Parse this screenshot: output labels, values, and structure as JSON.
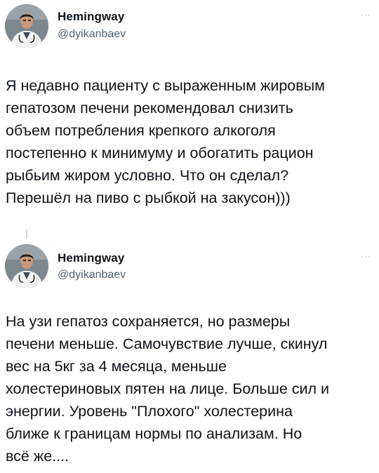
{
  "tweets": [
    {
      "author": {
        "name": "Hemingway",
        "handle": "@dyikanbaev",
        "avatar_icon": "doctor-portrait"
      },
      "more_icon": "ellipsis-icon",
      "more_label": "···",
      "text": "Я недавно пациенту с выраженным жировым\nгепатозом печени рекомендовал снизить\nобъем потребления крепкого алкоголя\nпостепенно к минимуму и обогатить рацион\nрыбьим жиром условно. Что он сделал?\nПерешёл на пиво с рыбкой на закусон)))"
    },
    {
      "author": {
        "name": "Hemingway",
        "handle": "@dyikanbaev",
        "avatar_icon": "doctor-portrait"
      },
      "more_icon": "ellipsis-icon",
      "more_label": "···",
      "text": "На узи гепатоз сохраняется, но размеры\nпечени меньше. Самочувствие лучше, скинул\nвес на 5кг за 4 месяца, меньше\nхолестериновых пятен на лице. Больше сил и\nэнергии. Уровень \"Плохого\" холестерина\nближе к границам нормы по анализам. Но\nвсё же...."
    }
  ],
  "colors": {
    "text": "#0f1419",
    "secondary": "#536471",
    "background": "#ffffff"
  }
}
